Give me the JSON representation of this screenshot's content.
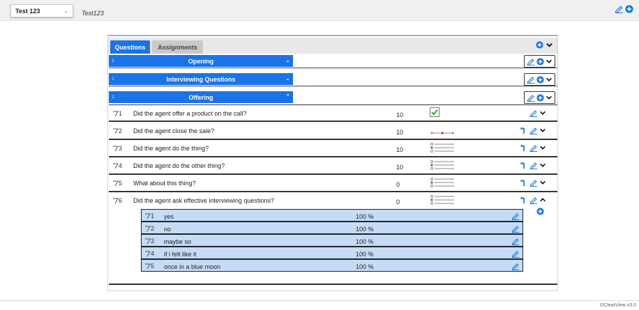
{
  "header": {
    "selected_form": "Test 123",
    "subtitle": "Test123"
  },
  "tabs": [
    {
      "label": "Questions",
      "active": true
    },
    {
      "label": "Assignments",
      "active": false
    }
  ],
  "sections": [
    {
      "title": "Opening",
      "expanded": false
    },
    {
      "title": "Interviewing Questions",
      "expanded": false
    },
    {
      "title": "Offering",
      "expanded": true
    }
  ],
  "questions": [
    {
      "number": "1",
      "text": "Did the agent offer a product on the call?",
      "points": "10",
      "type_icon": "checkbox-icon"
    },
    {
      "number": "2",
      "text": "Did the agent close the sale?",
      "points": "10",
      "type_icon": "slider-scale-icon"
    },
    {
      "number": "3",
      "text": "Did the agent do the thing?",
      "points": "10",
      "type_icon": "radio-list-icon"
    },
    {
      "number": "4",
      "text": "Did the agent do the other thing?",
      "points": "10",
      "type_icon": "radio-list-icon"
    },
    {
      "number": "5",
      "text": "What about this thing?",
      "points": "0",
      "type_icon": "radio-list-icon"
    },
    {
      "number": "6",
      "text": "Did the agent ask effective interviewing questions?",
      "points": "0",
      "type_icon": "radio-list-icon"
    }
  ],
  "answers": [
    {
      "number": "1",
      "text": "yes",
      "percent": "100 %"
    },
    {
      "number": "2",
      "text": "no",
      "percent": "100 %"
    },
    {
      "number": "3",
      "text": "maybe so",
      "percent": "100 %"
    },
    {
      "number": "4",
      "text": "if i felt like it",
      "percent": "100 %"
    },
    {
      "number": "5",
      "text": "once in a blue moon",
      "percent": "100 %"
    }
  ],
  "footer": {
    "version": "©ClearView v3.0"
  },
  "colors": {
    "primary_blue": "#1a73e8",
    "answer_bg": "#c4dcf6",
    "checkbox_green": "#3aa035"
  }
}
